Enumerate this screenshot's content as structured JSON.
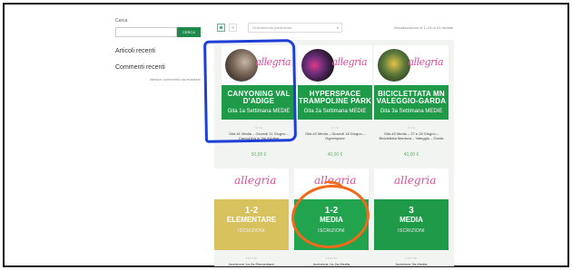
{
  "sidebar": {
    "search_label": "Cerca",
    "search_placeholder": "",
    "search_button": "CERCA",
    "recent_articles": "Articoli recenti",
    "recent_comments": "Commenti recenti",
    "no_comments": "Nessun commento da mostrare."
  },
  "toolbar": {
    "list_glyph": "☰",
    "sort_selected": "Ordinamento predefinito",
    "result_count": "Visualizzazione di 1–24 di 31 risultati"
  },
  "products": [
    {
      "title": "CANYONING VAL D'ADIGE",
      "subtitle": "Gita 1a Settimana MEDIE",
      "category": "GITE",
      "name": "Gita #1 Media – Giovedì 11 Giugno – Canyoning in Val d'Adige",
      "price": "50,00 €",
      "band_color": "#1f9a48"
    },
    {
      "title": "HYPERSPACE TRAMPOLINE PARK",
      "subtitle": "Gita 2a Settimana MEDIE",
      "category": "GITE",
      "name": "Gita #2 Media – Giovedì 18 Giugno – Hyperspace",
      "price": "40,00 €",
      "band_color": "#1f9a48"
    },
    {
      "title": "BICICLETTATA MN VALEGGIO-GARDA",
      "subtitle": "Gita 3a Settimana MEDIE",
      "category": "GITE",
      "name": "Gita #3 Media – 27 e 28 Giugno – Biciclettata Mantova – Valeggio – Garda",
      "price": "40,00 €",
      "band_color": "#1f9a48"
    },
    {
      "line1": "1-2",
      "line2": "ELEMENTARE",
      "line3": "ISCRIZIONI",
      "category": "CENTRI",
      "name": "Iscrizione 1a-2a Elementare",
      "band_color": "#d8c25e"
    },
    {
      "line1": "1-2",
      "line2": "MEDIA",
      "line3": "ISCRIZIONI",
      "category": "CENTRI",
      "name": "Iscrizione 1a-2a Media",
      "band_color": "#22a44e"
    },
    {
      "line1": "3",
      "line2": "MEDIA",
      "line3": "ISCRIZIONI",
      "category": "CENTRI",
      "name": "Iscrizione 3a Media",
      "band_color": "#1f9a48"
    }
  ],
  "logo_text": "allegria",
  "colors": {
    "accent_green": "#1f8a4c",
    "price_green": "#5fb86c",
    "annotation_blue": "#1d3fd6",
    "annotation_orange": "#ef6a1a"
  }
}
